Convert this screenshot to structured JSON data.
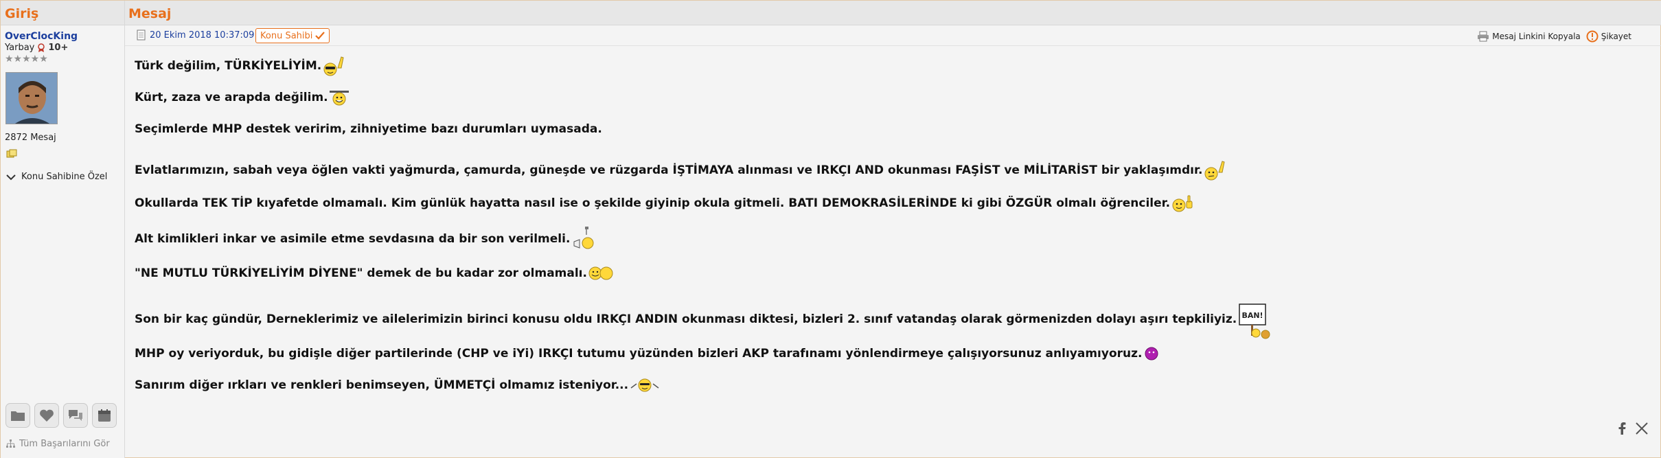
{
  "header": {
    "left_title": "Giriş",
    "right_title": "Mesaj"
  },
  "author": {
    "username": "OverClocKing",
    "rank": "Yarbay",
    "level": "10+",
    "stars": "★★★★★",
    "message_count": "2872 Mesaj",
    "owner_special": "Konu Sahibine Özel",
    "achievements": "Tüm Başarılarını Gör"
  },
  "post_meta": {
    "date": "20 Ekim 2018 10:37:09",
    "owner_tag": "Konu Sahibi",
    "copy_link": "Mesaj Linkini Kopyala",
    "complaint": "Şikayet"
  },
  "post_lines": [
    "Türk değilim, TÜRKİYELİYİM.",
    "Kürt, zaza ve arapda değilim.",
    "Seçimlerde MHP destek veririm, zihniyetime bazı durumları uymasada.",
    "Evlatlarımızın, sabah veya öğlen vakti yağmurda, çamurda, güneşde ve rüzgarda İŞTİMAYA alınması ve IRKÇI AND okunması FAŞİST ve MİLİTARİST bir yaklaşımdır.",
    "Okullarda TEK TİP kıyafetde olmamalı. Kim günlük hayatta nasıl ise o şekilde giyinip okula gitmeli. BATI DEMOKRASİLERİNDE ki gibi ÖZGÜR olmalı öğrenciler.",
    "Alt kimlikleri inkar ve asimile etme sevdasına da bir son verilmeli.",
    "\"NE MUTLU TÜRKİYELİYİM DİYENE\" demek de bu kadar zor olmamalı.",
    "Son bir kaç gündür, Derneklerimiz ve ailelerimizin birinci konusu oldu IRKÇI ANDIN okunması diktesi, bizleri 2. sınıf vatandaş olarak görmenizden dolayı aşırı tepkiliyiz.",
    "MHP oy veriyorduk, bu gidişle diğer partilerinde (CHP ve iYi) IRKÇI tutumu yüzünden bizleri AKP tarafınamı yönlendirmeye çalışıyorsunuz anlıyamıyoruz.",
    "Sanırım diğer ırkları ve renkleri benimseyen, ÜMMETÇİ olmamız isteniyor..."
  ],
  "sign_text": "BAN!",
  "colors": {
    "accent": "#e8701c",
    "link": "#1c3f9e",
    "border": "#e2c9a9"
  }
}
